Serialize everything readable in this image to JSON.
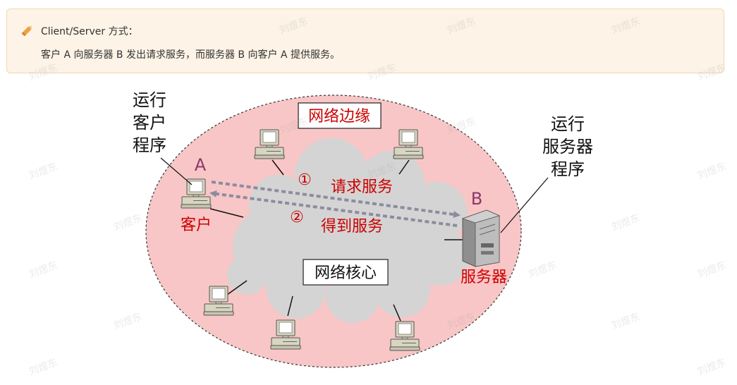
{
  "note": {
    "icon": "pencil-icon",
    "title": "Client/Server 方式：",
    "body": "客户 A 向服务器 B 发出请求服务，而服务器 B 向客户 A 提供服务。"
  },
  "diagram": {
    "edge_label": "网络边缘",
    "core_label": "网络核心",
    "client_program_lines": [
      "运行",
      "客户",
      "程序"
    ],
    "server_program_lines": [
      "运行",
      "服务器",
      "程序"
    ],
    "client_letter": "A",
    "server_letter": "B",
    "client_label": "客户",
    "server_label": "服务器",
    "request_num": "①",
    "request_label": "请求服务",
    "response_num": "②",
    "response_label": "得到服务",
    "colors": {
      "edge_fill": "#f8c6c6",
      "cloud_fill": "#d4d4d4",
      "red_text": "#cc0000",
      "letter": "#8a3a6a",
      "arrow": "#8c8ca0"
    }
  },
  "watermark": "刘煜东"
}
